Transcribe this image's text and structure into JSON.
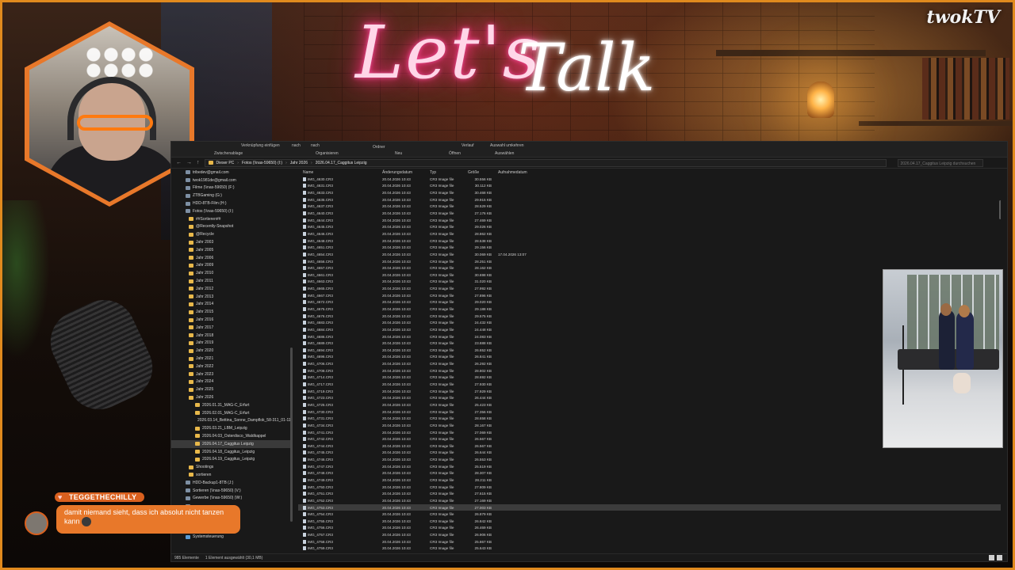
{
  "overlay": {
    "title_part1": "Let's",
    "title_part2": "Talk",
    "brand": "twokTV"
  },
  "explorer": {
    "ribbon": {
      "labels": [
        "Verknüpfung einfügen",
        "nach",
        "nach",
        "Ordner",
        "Verlauf",
        "Auswahl umkehren",
        "Zwischenablage",
        "Organisieren",
        "Neu",
        "Öffnen",
        "Auswählen"
      ]
    },
    "breadcrumb": [
      "Dieser PC",
      "Fotos (\\\\nas-59650) (I:)",
      "Jahr 2026",
      "2026.04.17_Caggitus Leipzig"
    ],
    "search_placeholder": "2026.04.17_Caggitus Leipzig durchsuchen",
    "sidebar": [
      {
        "label": "tribedev@gmail.com",
        "icon": "cloud"
      },
      {
        "label": "twok1981de@gmail.com",
        "icon": "cloud"
      },
      {
        "label": "Filme (\\\\nas-59650) (F:)",
        "icon": "drive"
      },
      {
        "label": "ZTBGaming (G:)",
        "icon": "drive"
      },
      {
        "label": "HDD-8TB-Film (H:)",
        "icon": "drive"
      },
      {
        "label": "Fotos (\\\\nas-59650) (I:)",
        "icon": "drive"
      },
      {
        "label": "##Sortieren##",
        "icon": "folder"
      },
      {
        "label": "@Recently-Snapshot",
        "icon": "folder"
      },
      {
        "label": "@Recycle",
        "icon": "folder"
      },
      {
        "label": "Jahr 2003",
        "icon": "folder"
      },
      {
        "label": "Jahr 2005",
        "icon": "folder"
      },
      {
        "label": "Jahr 2006",
        "icon": "folder"
      },
      {
        "label": "Jahr 2009",
        "icon": "folder"
      },
      {
        "label": "Jahr 2010",
        "icon": "folder"
      },
      {
        "label": "Jahr 2011",
        "icon": "folder"
      },
      {
        "label": "Jahr 2012",
        "icon": "folder"
      },
      {
        "label": "Jahr 2013",
        "icon": "folder"
      },
      {
        "label": "Jahr 2014",
        "icon": "folder"
      },
      {
        "label": "Jahr 2015",
        "icon": "folder"
      },
      {
        "label": "Jahr 2016",
        "icon": "folder"
      },
      {
        "label": "Jahr 2017",
        "icon": "folder"
      },
      {
        "label": "Jahr 2018",
        "icon": "folder"
      },
      {
        "label": "Jahr 2019",
        "icon": "folder"
      },
      {
        "label": "Jahr 2020",
        "icon": "folder"
      },
      {
        "label": "Jahr 2021",
        "icon": "folder"
      },
      {
        "label": "Jahr 2022",
        "icon": "folder"
      },
      {
        "label": "Jahr 2023",
        "icon": "folder"
      },
      {
        "label": "Jahr 2024",
        "icon": "folder"
      },
      {
        "label": "Jahr 2025",
        "icon": "folder"
      },
      {
        "label": "Jahr 2026",
        "icon": "folder"
      },
      {
        "label": "2026.01.31_MAG-C_Erfurt",
        "icon": "folder"
      },
      {
        "label": "2026.02.01_MAG-C_Erfurt",
        "icon": "folder"
      },
      {
        "label": "2026.03.14_Bettina_Sonne_Dampflok_58-311_01-1104",
        "icon": "folder"
      },
      {
        "label": "2026.03.21_LBM_Leipzig",
        "icon": "folder"
      },
      {
        "label": "2026.04.03_Osterdisco_Waldkappel",
        "icon": "folder"
      },
      {
        "label": "2026.04.17_Caggitus Leipzig",
        "icon": "folder",
        "selected": true
      },
      {
        "label": "2026.04.18_Caggitus_Leipzig",
        "icon": "folder"
      },
      {
        "label": "2026.04.19_Caggitus_Leipzig",
        "icon": "folder"
      },
      {
        "label": "Shootings",
        "icon": "folder"
      },
      {
        "label": "sortieren",
        "icon": "folder"
      },
      {
        "label": "HDD-Backup1-8TB (J:)",
        "icon": "drive"
      },
      {
        "label": "Sortieren (\\\\nas-59650) (V:)",
        "icon": "drive"
      },
      {
        "label": "Gewerbe (\\\\nas-59650) (W:)",
        "icon": "drive"
      },
      {
        "label": "",
        "icon": "drive"
      },
      {
        "label": "",
        "icon": "drive"
      },
      {
        "label": "",
        "icon": "drive"
      },
      {
        "label": "NAS-59650",
        "icon": "net"
      },
      {
        "label": "Systemsteuerung",
        "icon": "net"
      }
    ],
    "columns": {
      "name": "Name",
      "date": "Änderungsdatum",
      "type": "Typ",
      "size": "Größe",
      "taken": "Aufnahmedatum"
    },
    "files": [
      {
        "name": "IMG_4630.CR3",
        "date": "20.04.2026 10:43",
        "type": "CR3 Image file",
        "size": "30.556 KB"
      },
      {
        "name": "IMG_4631.CR3",
        "date": "20.04.2026 10:43",
        "type": "CR3 Image file",
        "size": "30.112 KB"
      },
      {
        "name": "IMG_4633.CR3",
        "date": "20.04.2026 10:43",
        "type": "CR3 Image file",
        "size": "30.468 KB"
      },
      {
        "name": "IMG_4635.CR3",
        "date": "20.04.2026 10:43",
        "type": "CR3 Image file",
        "size": "29.915 KB"
      },
      {
        "name": "IMG_4637.CR3",
        "date": "20.04.2026 10:43",
        "type": "CR3 Image file",
        "size": "28.529 KB"
      },
      {
        "name": "IMG_4640.CR3",
        "date": "20.04.2026 10:43",
        "type": "CR3 Image file",
        "size": "27.176 KB"
      },
      {
        "name": "IMG_4644.CR3",
        "date": "20.04.2026 10:43",
        "type": "CR3 Image file",
        "size": "27.469 KB"
      },
      {
        "name": "IMG_4645.CR3",
        "date": "20.04.2026 10:43",
        "type": "CR3 Image file",
        "size": "29.026 KB"
      },
      {
        "name": "IMG_4646.CR3",
        "date": "20.04.2026 10:43",
        "type": "CR3 Image file",
        "size": "28.862 KB"
      },
      {
        "name": "IMG_4648.CR3",
        "date": "20.04.2026 10:43",
        "type": "CR3 Image file",
        "size": "28.538 KB"
      },
      {
        "name": "IMG_4651.CR3",
        "date": "20.04.2026 10:43",
        "type": "CR3 Image file",
        "size": "29.156 KB"
      },
      {
        "name": "IMG_4654.CR3",
        "date": "20.04.2026 10:43",
        "type": "CR3 Image file",
        "size": "30.069 KB",
        "taken": "17.04.2026 13:07"
      },
      {
        "name": "IMG_4656.CR3",
        "date": "20.04.2026 10:43",
        "type": "CR3 Image file",
        "size": "28.251 KB"
      },
      {
        "name": "IMG_4657.CR3",
        "date": "20.04.2026 10:43",
        "type": "CR3 Image file",
        "size": "28.162 KB"
      },
      {
        "name": "IMG_4661.CR3",
        "date": "20.04.2026 10:43",
        "type": "CR3 Image file",
        "size": "30.698 KB"
      },
      {
        "name": "IMG_4663.CR3",
        "date": "20.04.2026 10:43",
        "type": "CR3 Image file",
        "size": "31.020 KB"
      },
      {
        "name": "IMG_4665.CR3",
        "date": "20.04.2026 10:43",
        "type": "CR3 Image file",
        "size": "27.992 KB"
      },
      {
        "name": "IMG_4667.CR3",
        "date": "20.04.2026 10:43",
        "type": "CR3 Image file",
        "size": "27.896 KB"
      },
      {
        "name": "IMG_4672.CR3",
        "date": "20.04.2026 10:43",
        "type": "CR3 Image file",
        "size": "29.020 KB"
      },
      {
        "name": "IMG_4675.CR3",
        "date": "20.04.2026 10:43",
        "type": "CR3 Image file",
        "size": "29.188 KB"
      },
      {
        "name": "IMG_4676.CR3",
        "date": "20.04.2026 10:43",
        "type": "CR3 Image file",
        "size": "29.575 KB"
      },
      {
        "name": "IMG_4683.CR3",
        "date": "20.04.2026 10:43",
        "type": "CR3 Image file",
        "size": "24.432 KB"
      },
      {
        "name": "IMG_4684.CR3",
        "date": "20.04.2026 10:43",
        "type": "CR3 Image file",
        "size": "24.448 KB"
      },
      {
        "name": "IMG_4686.CR3",
        "date": "20.04.2026 10:43",
        "type": "CR3 Image file",
        "size": "24.083 KB"
      },
      {
        "name": "IMG_4689.CR3",
        "date": "20.04.2026 10:43",
        "type": "CR3 Image file",
        "size": "23.888 KB"
      },
      {
        "name": "IMG_4694.CR3",
        "date": "20.04.2026 10:43",
        "type": "CR3 Image file",
        "size": "26.652 KB"
      },
      {
        "name": "IMG_4696.CR3",
        "date": "20.04.2026 10:43",
        "type": "CR3 Image file",
        "size": "26.841 KB"
      },
      {
        "name": "IMG_4706.CR3",
        "date": "20.04.2026 10:43",
        "type": "CR3 Image file",
        "size": "26.292 KB"
      },
      {
        "name": "IMG_4708.CR3",
        "date": "20.04.2026 10:43",
        "type": "CR3 Image file",
        "size": "28.802 KB"
      },
      {
        "name": "IMG_4714.CR3",
        "date": "20.04.2026 10:43",
        "type": "CR3 Image file",
        "size": "28.692 KB"
      },
      {
        "name": "IMG_4717.CR3",
        "date": "20.04.2026 10:43",
        "type": "CR3 Image file",
        "size": "27.930 KB"
      },
      {
        "name": "IMG_4719.CR3",
        "date": "20.04.2026 10:43",
        "type": "CR3 Image file",
        "size": "27.929 KB"
      },
      {
        "name": "IMG_4723.CR3",
        "date": "20.04.2026 10:43",
        "type": "CR3 Image file",
        "size": "26.444 KB"
      },
      {
        "name": "IMG_4725.CR3",
        "date": "20.04.2026 10:43",
        "type": "CR3 Image file",
        "size": "25.423 KB"
      },
      {
        "name": "IMG_4730.CR3",
        "date": "20.04.2026 10:43",
        "type": "CR3 Image file",
        "size": "27.356 KB"
      },
      {
        "name": "IMG_4731.CR3",
        "date": "20.04.2026 10:43",
        "type": "CR3 Image file",
        "size": "28.658 KB"
      },
      {
        "name": "IMG_4734.CR3",
        "date": "20.04.2026 10:43",
        "type": "CR3 Image file",
        "size": "28.167 KB"
      },
      {
        "name": "IMG_4741.CR3",
        "date": "20.04.2026 10:43",
        "type": "CR3 Image file",
        "size": "27.069 KB"
      },
      {
        "name": "IMG_4742.CR3",
        "date": "20.04.2026 10:43",
        "type": "CR3 Image file",
        "size": "26.567 KB"
      },
      {
        "name": "IMG_4744.CR3",
        "date": "20.04.2026 10:43",
        "type": "CR3 Image file",
        "size": "26.567 KB"
      },
      {
        "name": "IMG_4745.CR3",
        "date": "20.04.2026 10:43",
        "type": "CR3 Image file",
        "size": "26.644 KB"
      },
      {
        "name": "IMG_4746.CR3",
        "date": "20.04.2026 10:43",
        "type": "CR3 Image file",
        "size": "26.553 KB"
      },
      {
        "name": "IMG_4747.CR3",
        "date": "20.04.2026 10:43",
        "type": "CR3 Image file",
        "size": "25.519 KB"
      },
      {
        "name": "IMG_4748.CR3",
        "date": "20.04.2026 10:43",
        "type": "CR3 Image file",
        "size": "28.307 KB"
      },
      {
        "name": "IMG_4749.CR3",
        "date": "20.04.2026 10:43",
        "type": "CR3 Image file",
        "size": "28.211 KB"
      },
      {
        "name": "IMG_4750.CR3",
        "date": "20.04.2026 10:43",
        "type": "CR3 Image file",
        "size": "27.809 KB"
      },
      {
        "name": "IMG_4751.CR3",
        "date": "20.04.2026 10:43",
        "type": "CR3 Image file",
        "size": "27.615 KB"
      },
      {
        "name": "IMG_4752.CR3",
        "date": "20.04.2026 10:43",
        "type": "CR3 Image file",
        "size": "27.169 KB"
      },
      {
        "name": "IMG_4753.CR3",
        "date": "20.04.2026 10:43",
        "type": "CR3 Image file",
        "size": "27.003 KB",
        "selected": true
      },
      {
        "name": "IMG_4754.CR3",
        "date": "20.04.2026 10:43",
        "type": "CR3 Image file",
        "size": "26.879 KB"
      },
      {
        "name": "IMG_4755.CR3",
        "date": "20.04.2026 10:43",
        "type": "CR3 Image file",
        "size": "26.842 KB"
      },
      {
        "name": "IMG_4756.CR3",
        "date": "20.04.2026 10:43",
        "type": "CR3 Image file",
        "size": "26.469 KB"
      },
      {
        "name": "IMG_4757.CR3",
        "date": "20.04.2026 10:43",
        "type": "CR3 Image file",
        "size": "26.906 KB"
      },
      {
        "name": "IMG_4758.CR3",
        "date": "20.04.2026 10:43",
        "type": "CR3 Image file",
        "size": "25.867 KB"
      },
      {
        "name": "IMG_4759.CR3",
        "date": "20.04.2026 10:43",
        "type": "CR3 Image file",
        "size": "25.643 KB"
      },
      {
        "name": "IMG_4760.CR3",
        "date": "20.04.2026 10:44",
        "type": "CR3 Image file",
        "size": "25.404 KB"
      }
    ],
    "status": {
      "count": "985 Elemente",
      "selection": "1 Element ausgewählt (30,1 MB)"
    }
  },
  "chat": {
    "username": "TEGGETHECHILLY",
    "message": "damit niemand sieht, dass ich absolut nicht tanzen kann"
  },
  "colors": {
    "accent": "#e8782a",
    "frame": "#e08a1e",
    "explorer_bg": "#191919"
  }
}
